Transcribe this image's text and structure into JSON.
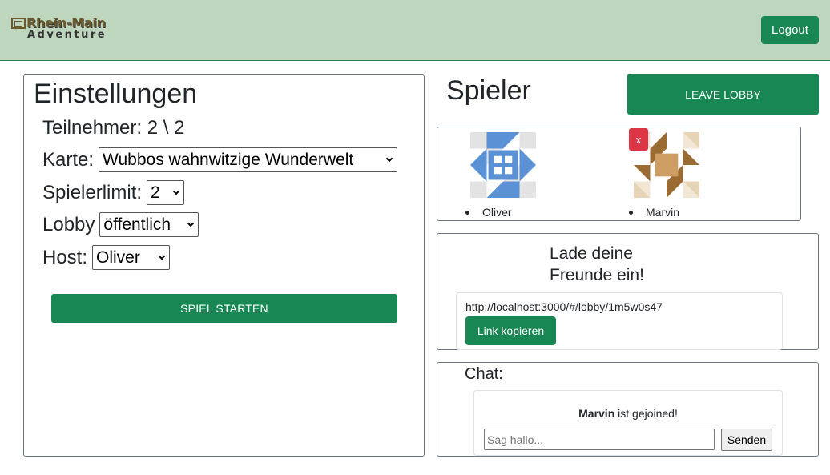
{
  "header": {
    "logo_line1": "Rhein-Main",
    "logo_line2": "Adventure",
    "logout_label": "Logout",
    "bg_color": "#bdd6bd"
  },
  "settings": {
    "title": "Einstellungen",
    "participants_label": "Teilnehmer: 2 \\ 2",
    "map_label": "Karte:",
    "map_value": "Wubbos wahnwitzige Wunderwelt",
    "player_limit_label": "Spielerlimit:",
    "player_limit_value": "2",
    "lobby_label": "Lobby",
    "lobby_value": "öffentlich",
    "host_label": "Host:",
    "host_value": "Oliver",
    "start_label": "SPIEL STARTEN"
  },
  "players": {
    "title": "Spieler",
    "leave_label": "LEAVE LOBBY",
    "kick_label": "x",
    "list": [
      {
        "name": "Oliver",
        "avatar_icon": "identicon-blue-icon",
        "color": "#5b92d6"
      },
      {
        "name": "Marvin",
        "avatar_icon": "identicon-brown-icon",
        "color": "#9b6b34"
      }
    ]
  },
  "invite": {
    "title": "Lade deine Freunde ein!",
    "link": "http://localhost:3000/#/lobby/1m5w0s47",
    "copy_label": "Link kopieren"
  },
  "chat": {
    "title": "Chat:",
    "message_user": "Marvin",
    "message_text": " ist gejoined!",
    "input_placeholder": "Sag hallo...",
    "send_label": "Senden"
  },
  "colors": {
    "accent": "#198754",
    "danger": "#dc3545"
  }
}
